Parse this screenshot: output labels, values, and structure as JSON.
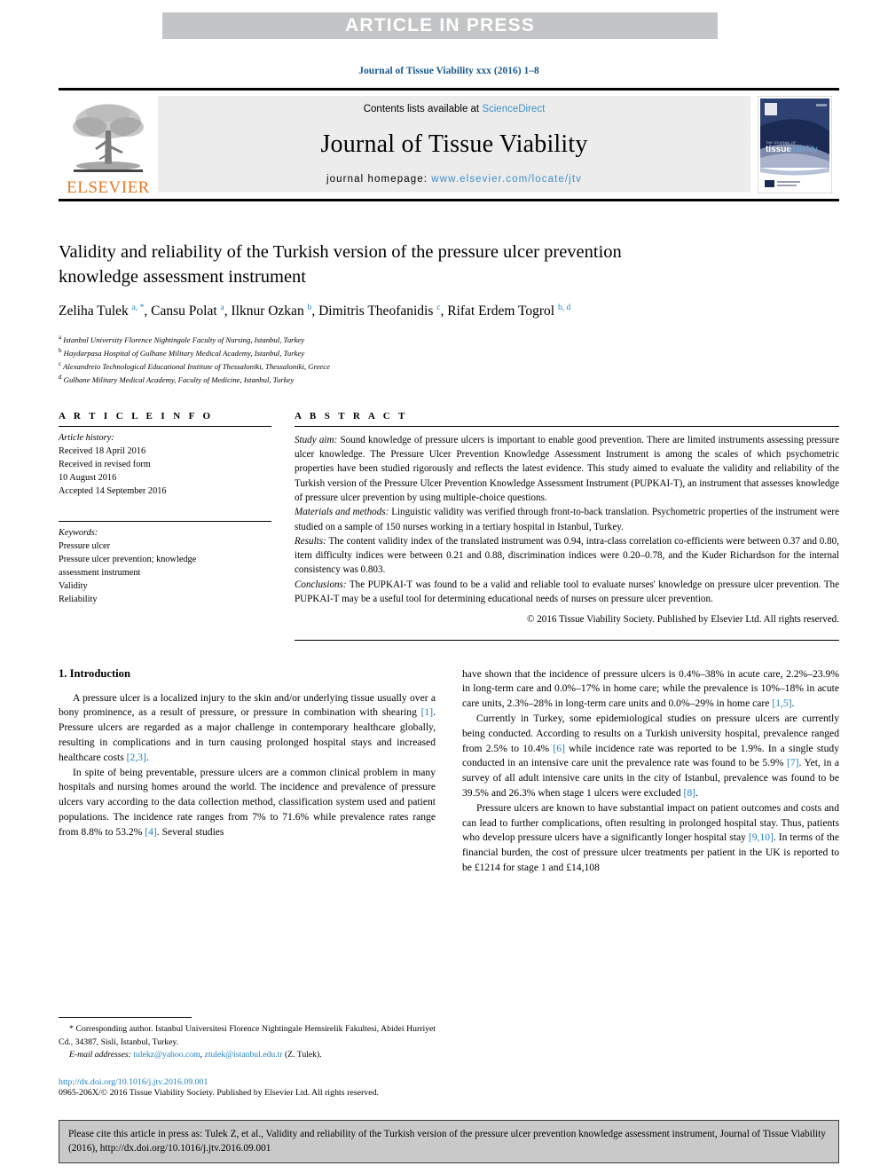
{
  "banner": {
    "text": "ARTICLE IN PRESS"
  },
  "journal_ref": "Journal of Tissue Viability xxx (2016) 1–8",
  "masthead": {
    "elsevier_word": "ELSEVIER",
    "contents_prefix": "Contents lists available at ",
    "contents_link": "ScienceDirect",
    "journal_name": "Journal of Tissue Viability",
    "homepage_prefix": "journal homepage: ",
    "homepage_link": "www.elsevier.com/locate/jtv",
    "cover_title_1": "tissue",
    "cover_title_2": "viability"
  },
  "article": {
    "title": "Validity and reliability of the Turkish version of the pressure ulcer prevention knowledge assessment instrument",
    "authors_html": "Zeliha Tulek <sup>a, *</sup>, Cansu Polat <sup>a</sup>, Ilknur Ozkan <sup>b</sup>, Dimitris Theofanidis <sup>c</sup>, Rifat Erdem Togrol <sup>b, d</sup>",
    "affiliations": [
      {
        "marker": "a",
        "text": "Istanbul University Florence Nightingale Faculty of Nursing, Istanbul, Turkey"
      },
      {
        "marker": "b",
        "text": "Haydarpasa Hospital of Gulhane Military Medical Academy, Istanbul, Turkey"
      },
      {
        "marker": "c",
        "text": "Alexandreio Technological Educational Institute of Thessaloniki, Thessaloniki, Greece"
      },
      {
        "marker": "d",
        "text": "Gulhane Military Medical Academy, Faculty of Medicine, Istanbul, Turkey"
      }
    ]
  },
  "article_info": {
    "heading": "A R T I C L E  I N F O",
    "history_label": "Article history:",
    "history_lines": [
      "Received 18 April 2016",
      "Received in revised form",
      "10 August 2016",
      "Accepted 14 September 2016"
    ],
    "keywords_label": "Keywords:",
    "keywords": [
      "Pressure ulcer",
      "Pressure ulcer prevention; knowledge",
      "assessment instrument",
      "Validity",
      "Reliability"
    ]
  },
  "abstract": {
    "heading": "A B S T R A C T",
    "sections": [
      {
        "label": "Study aim:",
        "text": " Sound knowledge of pressure ulcers is important to enable good prevention. There are limited instruments assessing pressure ulcer knowledge. The Pressure Ulcer Prevention Knowledge Assessment Instrument is among the scales of which psychometric properties have been studied rigorously and reflects the latest evidence. This study aimed to evaluate the validity and reliability of the Turkish version of the Pressure Ulcer Prevention Knowledge Assessment Instrument (PUPKAI-T), an instrument that assesses knowledge of pressure ulcer prevention by using multiple-choice questions."
      },
      {
        "label": "Materials and methods:",
        "text": " Linguistic validity was verified through front-to-back translation. Psychometric properties of the instrument were studied on a sample of 150 nurses working in a tertiary hospital in Istanbul, Turkey."
      },
      {
        "label": "Results:",
        "text": " The content validity index of the translated instrument was 0.94, intra-class correlation co-efficients were between 0.37 and 0.80, item difficulty indices were between 0.21 and 0.88, discrimination indices were 0.20–0.78, and the Kuder Richardson for the internal consistency was 0.803."
      },
      {
        "label": "Conclusions:",
        "text": " The PUPKAI-T was found to be a valid and reliable tool to evaluate nurses' knowledge on pressure ulcer prevention. The PUPKAI-T may be a useful tool for determining educational needs of nurses on pressure ulcer prevention."
      }
    ],
    "copyright": "© 2016 Tissue Viability Society. Published by Elsevier Ltd. All rights reserved."
  },
  "introduction": {
    "heading": "1. Introduction",
    "left_paragraphs": [
      "A pressure ulcer is a localized injury to the skin and/or underlying tissue usually over a bony prominence, as a result of pressure, or pressure in combination with shearing [1]. Pressure ulcers are regarded as a major challenge in contemporary healthcare globally, resulting in complications and in turn causing prolonged hospital stays and increased healthcare costs [2,3].",
      "In spite of being preventable, pressure ulcers are a common clinical problem in many hospitals and nursing homes around the world. The incidence and prevalence of pressure ulcers vary according to the data collection method, classification system used and patient populations. The incidence rate ranges from 7% to 71.6% while prevalence rates range from 8.8% to 53.2% [4]. Several studies"
    ],
    "right_paragraphs": [
      "have shown that the incidence of pressure ulcers is 0.4%–38% in acute care, 2.2%–23.9% in long-term care and 0.0%–17% in home care; while the prevalence is 10%–18% in acute care units, 2.3%–28% in long-term care units and 0.0%–29% in home care [1,5].",
      "Currently in Turkey, some epidemiological studies on pressure ulcers are currently being conducted. According to results on a Turkish university hospital, prevalence ranged from 2.5% to 10.4% [6] while incidence rate was reported to be 1.9%. In a single study conducted in an intensive care unit the prevalence rate was found to be 5.9% [7]. Yet, in a survey of all adult intensive care units in the city of Istanbul, prevalence was found to be 39.5% and 26.3% when stage 1 ulcers were excluded [8].",
      "Pressure ulcers are known to have substantial impact on patient outcomes and costs and can lead to further complications, often resulting in prolonged hospital stay. Thus, patients who develop pressure ulcers have a significantly longer hospital stay [9,10]. In terms of the financial burden, the cost of pressure ulcer treatments per patient in the UK is reported to be £1214 for stage 1 and £14,108"
    ]
  },
  "footnote": {
    "corresponding_marker": "*",
    "corresponding_text": " Corresponding author. Istanbul Universitesi Florence Nightingale Hemsirelik Fakultesi, Abidei Hurriyet Cd., 34387, Sisli, Istanbul, Turkey.",
    "email_label": "E-mail addresses:",
    "email_1": "tulekz@yahoo.com",
    "email_2": "ztulek@istanbul.edu.tr",
    "email_suffix": " (Z. Tulek).",
    "doi": "http://dx.doi.org/10.1016/j.jtv.2016.09.001",
    "issn_line": "0965-206X/© 2016 Tissue Viability Society. Published by Elsevier Ltd. All rights reserved."
  },
  "cite_box": {
    "text": "Please cite this article in press as: Tulek Z, et al., Validity and reliability of the Turkish version of the pressure ulcer prevention knowledge assessment instrument, Journal of Tissue Viability (2016), http://dx.doi.org/10.1016/j.jtv.2016.09.001"
  },
  "colors": {
    "link_blue": "#3f8fc5",
    "ref_blue": "#1f7fc0",
    "journal_ref_blue": "#1a5a8e",
    "elsevier_orange": "#e87722",
    "banner_gray": "#c3c4c6",
    "masthead_gray": "#ececec",
    "cite_gray": "#c9c9c9",
    "cover_navy": "#1b2a52"
  }
}
